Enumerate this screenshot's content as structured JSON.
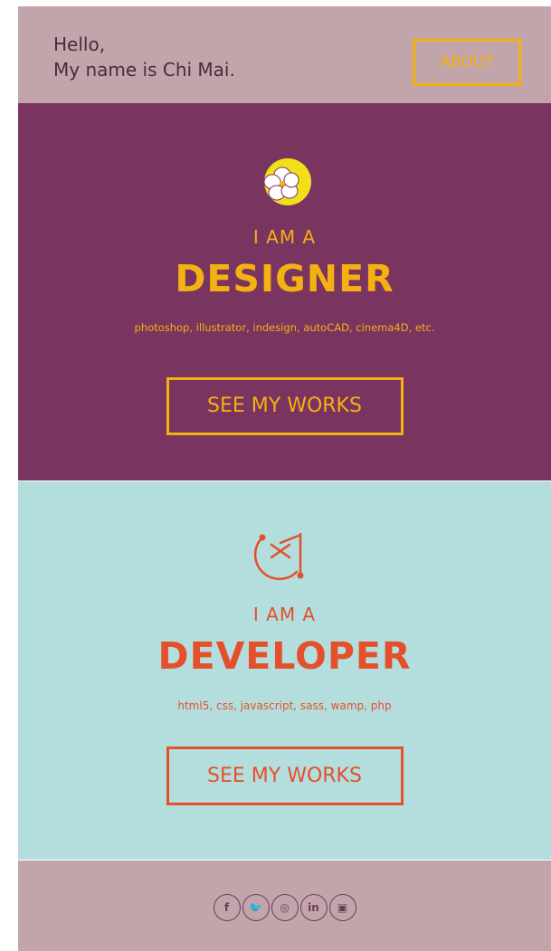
{
  "header": {
    "greeting_line1": "Hello,",
    "greeting_line2": "My name is Chi Mai.",
    "about_label": "ABOUT"
  },
  "designer": {
    "icon": "flower-icon",
    "iam": "I AM A",
    "role": "DESIGNER",
    "skills": "photoshop, illustrator, indesign, autoCAD, cinema4D, etc.",
    "button": "SEE MY WORKS"
  },
  "developer": {
    "icon": "code-face-icon",
    "iam": "I AM A",
    "role": "DEVELOPER",
    "skills": "html5, css, javascript, sass, wamp, php",
    "button": "SEE MY WORKS"
  },
  "footer": {
    "social": [
      {
        "name": "facebook-icon",
        "glyph": "f"
      },
      {
        "name": "twitter-icon",
        "glyph": "🐦"
      },
      {
        "name": "instagram-icon",
        "glyph": "◎"
      },
      {
        "name": "linkedin-icon",
        "glyph": "in"
      },
      {
        "name": "youtube-icon",
        "glyph": "▣"
      }
    ]
  },
  "colors": {
    "header_bg": "#c2a4ab",
    "designer_bg": "#7a3460",
    "designer_accent": "#f5b111",
    "developer_bg": "#b4dede",
    "developer_accent": "#e4502b"
  }
}
